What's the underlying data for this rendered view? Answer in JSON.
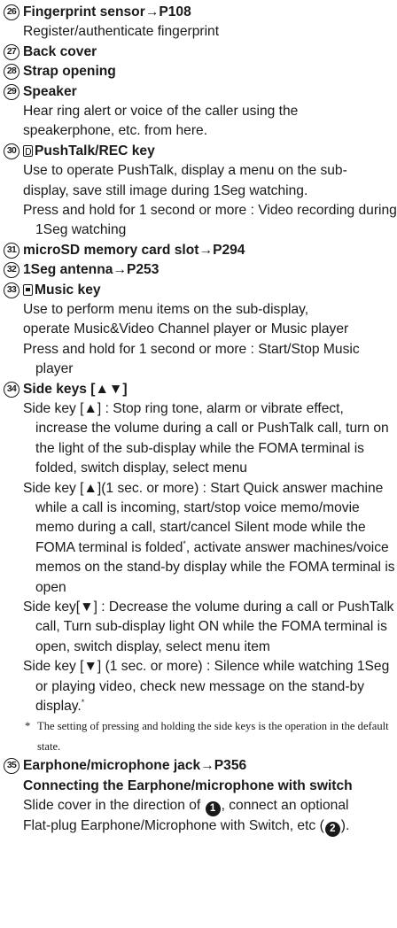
{
  "entries": [
    {
      "num": "26",
      "title": "Fingerprint sensor",
      "ref": "→P108",
      "lines": [
        "Register/authenticate fingerprint"
      ]
    },
    {
      "num": "27",
      "title": "Back cover"
    },
    {
      "num": "28",
      "title": "Strap opening"
    },
    {
      "num": "29",
      "title": "Speaker",
      "lines": [
        "Hear ring alert or voice of the caller using the",
        "speakerphone, etc. from here."
      ]
    },
    {
      "num": "30",
      "title": "PushTalk/REC key",
      "icon": "push-talk-key-icon",
      "lines": [
        "Use to operate PushTalk, display a menu on the sub-",
        "display, save still image during 1Seg watching."
      ],
      "hang": "Press and hold for 1 second or more : Video recording during 1Seg watching"
    },
    {
      "num": "31",
      "title": "microSD memory card slot",
      "ref": "→P294"
    },
    {
      "num": "32",
      "title": "1Seg antenna",
      "ref": "→P253"
    },
    {
      "num": "33",
      "title": "Music key",
      "icon": "music-key-icon",
      "lines": [
        "Use to perform menu items on the sub-display,",
        "operate Music&Video Channel player or Music player"
      ],
      "hang": "Press and hold for 1 second or more : Start/Stop Music player"
    },
    {
      "num": "34",
      "title": "Side keys [▲▼]",
      "items": [
        "Side key [▲] : Stop ring tone, alarm or vibrate effect, increase the volume during a call or PushTalk call, turn on the light of the sub-display while the FOMA terminal is folded, switch display, select menu",
        "Side key [▲](1 sec. or more) : Start Quick answer machine while a call is incoming, start/stop voice memo/movie memo during a call, start/cancel Silent mode while the FOMA terminal is folded",
        "Side key[▼] : Decrease the volume during a call or PushTalk call, Turn sub-display light ON while the FOMA terminal is open, switch display, select menu item",
        "Side key [▼] (1 sec. or more) : Silence while watching 1Seg or playing video, check new message on the stand-by display."
      ],
      "item2_tail": ", activate answer machines/voice memos on the stand-by display while the FOMA terminal is open",
      "note_mark": "*",
      "note": "The setting of pressing and holding the side keys is the operation in the default state."
    },
    {
      "num": "35",
      "title": "Earphone/microphone jack",
      "ref": "→P356",
      "subhead": "Connecting the Earphone/microphone with switch",
      "text_a": "Slide cover in the direction of ",
      "step1": "1",
      "text_b": ", connect an optional",
      "text_c": "Flat-plug Earphone/Microphone with Switch, etc (",
      "step2": "2",
      "text_d": ")."
    }
  ]
}
